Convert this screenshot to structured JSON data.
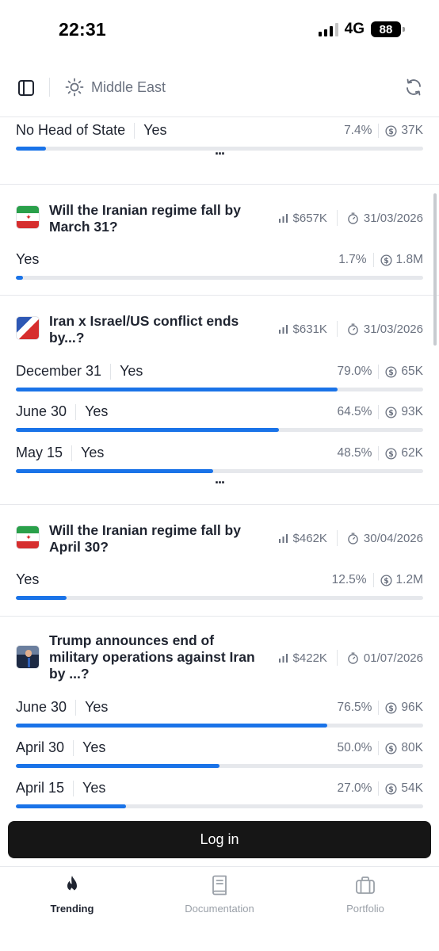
{
  "status_bar": {
    "time": "22:31",
    "network": "4G",
    "battery": "88"
  },
  "header": {
    "category": "Middle East"
  },
  "cards": [
    {
      "rows": [
        {
          "label": "No Head of State",
          "outcome": "Yes",
          "percent": "7.4%",
          "volume": "37K",
          "fill": 0.074
        }
      ],
      "more": "..."
    },
    {
      "title": "Will the Iranian regime fall by March 31?",
      "avatar": "iran-flag-icon",
      "total_volume": "$657K",
      "end_date": "31/03/2026",
      "rows": [
        {
          "label": "Yes",
          "percent": "1.7%",
          "volume": "1.8M",
          "fill": 0.017
        }
      ]
    },
    {
      "title": "Iran x Israel/US conflict ends by...?",
      "avatar": "iran-israel-flag-icon",
      "total_volume": "$631K",
      "end_date": "31/03/2026",
      "rows": [
        {
          "label": "December 31",
          "outcome": "Yes",
          "percent": "79.0%",
          "volume": "65K",
          "fill": 0.79
        },
        {
          "label": "June 30",
          "outcome": "Yes",
          "percent": "64.5%",
          "volume": "93K",
          "fill": 0.645
        },
        {
          "label": "May 15",
          "outcome": "Yes",
          "percent": "48.5%",
          "volume": "62K",
          "fill": 0.485
        }
      ],
      "more": "..."
    },
    {
      "title": "Will the Iranian regime fall by April 30?",
      "avatar": "iran-flag-icon",
      "total_volume": "$462K",
      "end_date": "30/04/2026",
      "rows": [
        {
          "label": "Yes",
          "percent": "12.5%",
          "volume": "1.2M",
          "fill": 0.125
        }
      ]
    },
    {
      "title": "Trump announces end of military operations against Iran by ...?",
      "avatar": "trump-photo",
      "total_volume": "$422K",
      "end_date": "01/07/2026",
      "rows": [
        {
          "label": "June 30",
          "outcome": "Yes",
          "percent": "76.5%",
          "volume": "96K",
          "fill": 0.765
        },
        {
          "label": "April 30",
          "outcome": "Yes",
          "percent": "50.0%",
          "volume": "80K",
          "fill": 0.5
        },
        {
          "label": "April 15",
          "outcome": "Yes",
          "percent": "27.0%",
          "volume": "54K",
          "fill": 0.27
        }
      ]
    }
  ],
  "login_label": "Log in",
  "nav": [
    {
      "label": "Trending",
      "icon": "flame-icon",
      "active": true
    },
    {
      "label": "Documentation",
      "icon": "book-icon",
      "active": false
    },
    {
      "label": "Portfolio",
      "icon": "briefcase-icon",
      "active": false
    }
  ]
}
